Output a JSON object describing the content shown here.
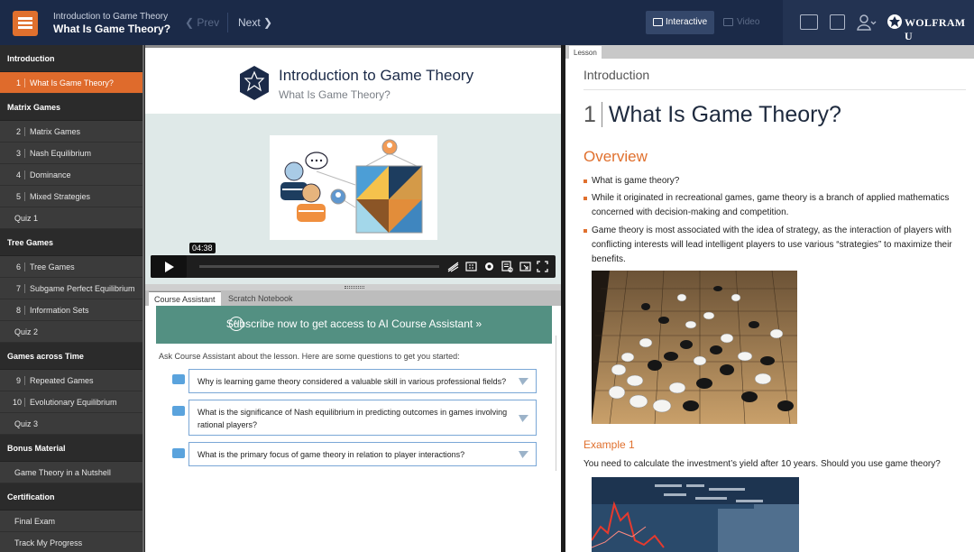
{
  "header": {
    "course_subtitle": "Introduction to Game Theory",
    "course_title": "What Is Game Theory?",
    "prev_label": "Prev",
    "next_label": "Next",
    "mode_interactive": "Interactive",
    "mode_video": "Video",
    "brand": "WOLFRAM U"
  },
  "sidebar": {
    "sections": [
      {
        "title": "Introduction",
        "items": [
          {
            "num": "1",
            "label": "What Is Game Theory?",
            "active": true
          }
        ]
      },
      {
        "title": "Matrix Games",
        "items": [
          {
            "num": "2",
            "label": "Matrix Games"
          },
          {
            "num": "3",
            "label": "Nash Equilibrium"
          },
          {
            "num": "4",
            "label": "Dominance"
          },
          {
            "num": "5",
            "label": "Mixed Strategies"
          },
          {
            "num": "",
            "label": "Quiz 1"
          }
        ]
      },
      {
        "title": "Tree Games",
        "items": [
          {
            "num": "6",
            "label": "Tree Games"
          },
          {
            "num": "7",
            "label": "Subgame Perfect Equilibrium"
          },
          {
            "num": "8",
            "label": "Information Sets"
          },
          {
            "num": "",
            "label": "Quiz 2"
          }
        ]
      },
      {
        "title": "Games across Time",
        "items": [
          {
            "num": "9",
            "label": "Repeated Games"
          },
          {
            "num": "10",
            "label": "Evolutionary Equilibrium"
          },
          {
            "num": "",
            "label": "Quiz 3"
          }
        ]
      },
      {
        "title": "Bonus Material",
        "items": [
          {
            "num": "",
            "label": "Game Theory in a Nutshell"
          }
        ]
      },
      {
        "title": "Certification",
        "items": [
          {
            "num": "",
            "label": "Final Exam"
          },
          {
            "num": "",
            "label": "Track My Progress"
          }
        ]
      }
    ]
  },
  "video": {
    "title": "Introduction to Game Theory",
    "subtitle": "What Is Game Theory?",
    "timestamp": "04:38",
    "controls": [
      "sound-off-icon",
      "captions-icon",
      "settings-icon",
      "transcript-icon",
      "fullscreen-icon"
    ]
  },
  "assistant": {
    "tabs": [
      "Course Assistant",
      "Scratch Notebook"
    ],
    "subscribe_text": "Subscribe now to get access to AI Course Assistant »",
    "ai_badge": "AI",
    "intro": "Ask Course Assistant about the lesson. Here are some questions to get you started:",
    "questions": [
      "Why is learning game theory considered a valuable skill in various professional fields?",
      "What is the significance of Nash equilibrium in predicting outcomes in games involving rational players?",
      "What is the primary focus of game theory in relation to player interactions?"
    ]
  },
  "lesson": {
    "tab": "Lesson",
    "section": "Introduction",
    "number": "1",
    "title": "What Is Game Theory?",
    "overview_heading": "Overview",
    "bullets": [
      "What is game theory?",
      "While it originated in recreational games, game theory is a branch of applied mathematics concerned with decision-making and competition.",
      "Game theory is most associated with the idea of strategy, as the interaction of players with conflicting interests will lead intelligent players to use various “strategies” to maximize their benefits."
    ],
    "example_heading": "Example 1",
    "example_text": "You need to calculate the investment’s yield after 10 years. Should you use game theory?"
  },
  "colors": {
    "accent": "#e0702e",
    "navy": "#1b2a48",
    "teal": "#539082"
  }
}
